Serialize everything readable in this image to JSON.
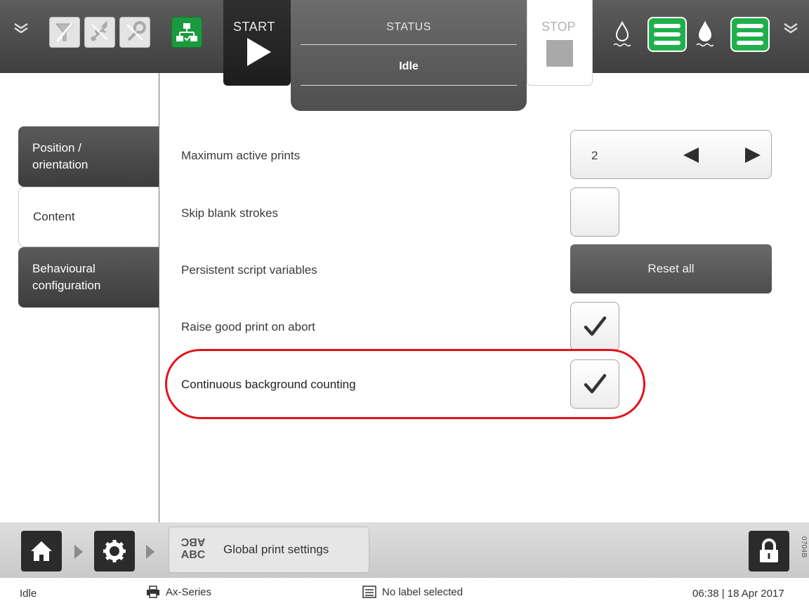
{
  "header": {
    "start_label": "START",
    "status_title": "STATUS",
    "status_value": "Idle",
    "stop_label": "STOP",
    "icons": [
      "chevron-down-icon",
      "filter-icon",
      "usb-icon",
      "tool-icon",
      "network-icon",
      "ink-drop-icon",
      "ink-level-icon",
      "ink-drop-icon",
      "ink-level-icon",
      "chevron-down-icon"
    ],
    "colors": {
      "ink_ok": "#1fb04c",
      "network_ok": "#1a9a3e",
      "highlight": "#e3141b"
    }
  },
  "sidebar": {
    "items": [
      {
        "label_line1": "Position /",
        "label_line2": "orientation",
        "selected": false
      },
      {
        "label": "Content",
        "selected": true
      },
      {
        "label_line1": "Behavioural",
        "label_line2": "configuration",
        "selected": false
      }
    ]
  },
  "settings": {
    "max_active_prints": {
      "label": "Maximum active prints",
      "value": "2"
    },
    "skip_blank_strokes": {
      "label": "Skip blank strokes",
      "checked": false
    },
    "persistent_script_variables": {
      "label": "Persistent script variables",
      "button_label": "Reset all"
    },
    "raise_good_print_on_abort": {
      "label": "Raise good print on abort",
      "checked": true
    },
    "continuous_background_counting": {
      "label": "Continuous background counting",
      "checked": true,
      "highlighted": true
    }
  },
  "breadcrumb": {
    "icon_text_flipped": "ABC",
    "icon_text": "ABC",
    "current_label": "Global print settings",
    "version_code": "0704B"
  },
  "statusbar": {
    "state": "Idle",
    "printer": "Ax-Series",
    "label": "No label selected",
    "datetime": "06:38 | 18 Apr 2017"
  }
}
